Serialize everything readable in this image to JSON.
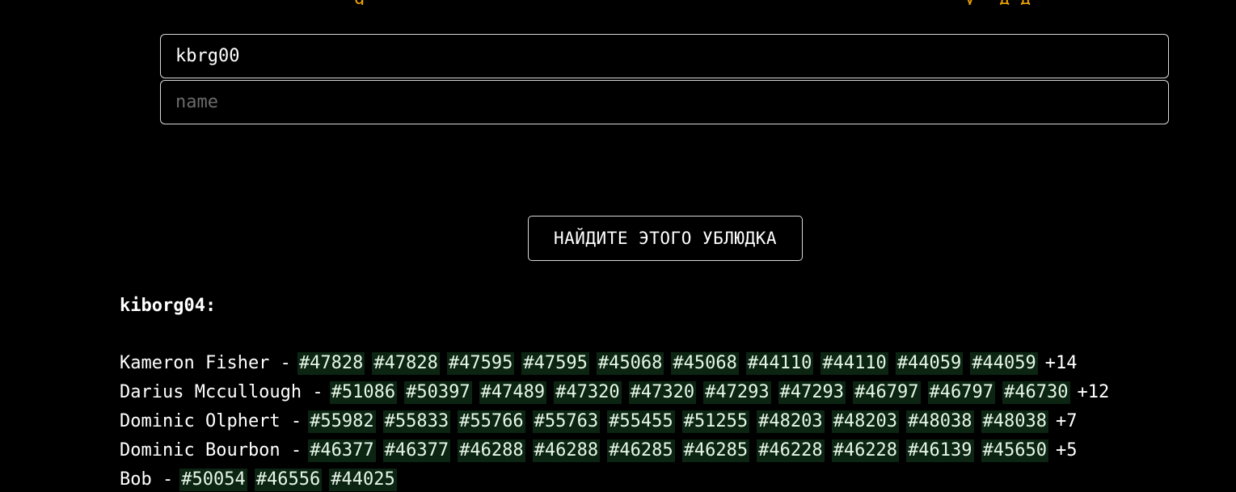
{
  "inputs": [
    {
      "value": "kbrg00",
      "placeholder": ""
    },
    {
      "value": "",
      "placeholder": "name"
    }
  ],
  "submit_label": "НАЙДИТЕ ЭТОГО УБЛЮДКА",
  "result": {
    "heading": "kiborg04:",
    "separator": "-",
    "rows": [
      {
        "name": "Kameron Fisher",
        "tags": [
          "#47828",
          "#47828",
          "#47595",
          "#47595",
          "#45068",
          "#45068",
          "#44110",
          "#44110",
          "#44059",
          "#44059"
        ],
        "more": "+14"
      },
      {
        "name": "Darius Mccullough",
        "tags": [
          "#51086",
          "#50397",
          "#47489",
          "#47320",
          "#47320",
          "#47293",
          "#47293",
          "#46797",
          "#46797",
          "#46730"
        ],
        "more": "+12"
      },
      {
        "name": "Dominic Olphert",
        "tags": [
          "#55982",
          "#55833",
          "#55766",
          "#55763",
          "#55455",
          "#51255",
          "#48203",
          "#48203",
          "#48038",
          "#48038"
        ],
        "more": "+7"
      },
      {
        "name": "Dominic Bourbon",
        "tags": [
          "#46377",
          "#46377",
          "#46288",
          "#46288",
          "#46285",
          "#46285",
          "#46228",
          "#46228",
          "#46139",
          "#45650"
        ],
        "more": "+5"
      },
      {
        "name": "Bob",
        "tags": [
          "#50054",
          "#46556",
          "#44025"
        ],
        "more": ""
      }
    ]
  },
  "colors": {
    "background": "#000000",
    "tag_background": "#0b2512",
    "header_partial": "#f0a500"
  }
}
